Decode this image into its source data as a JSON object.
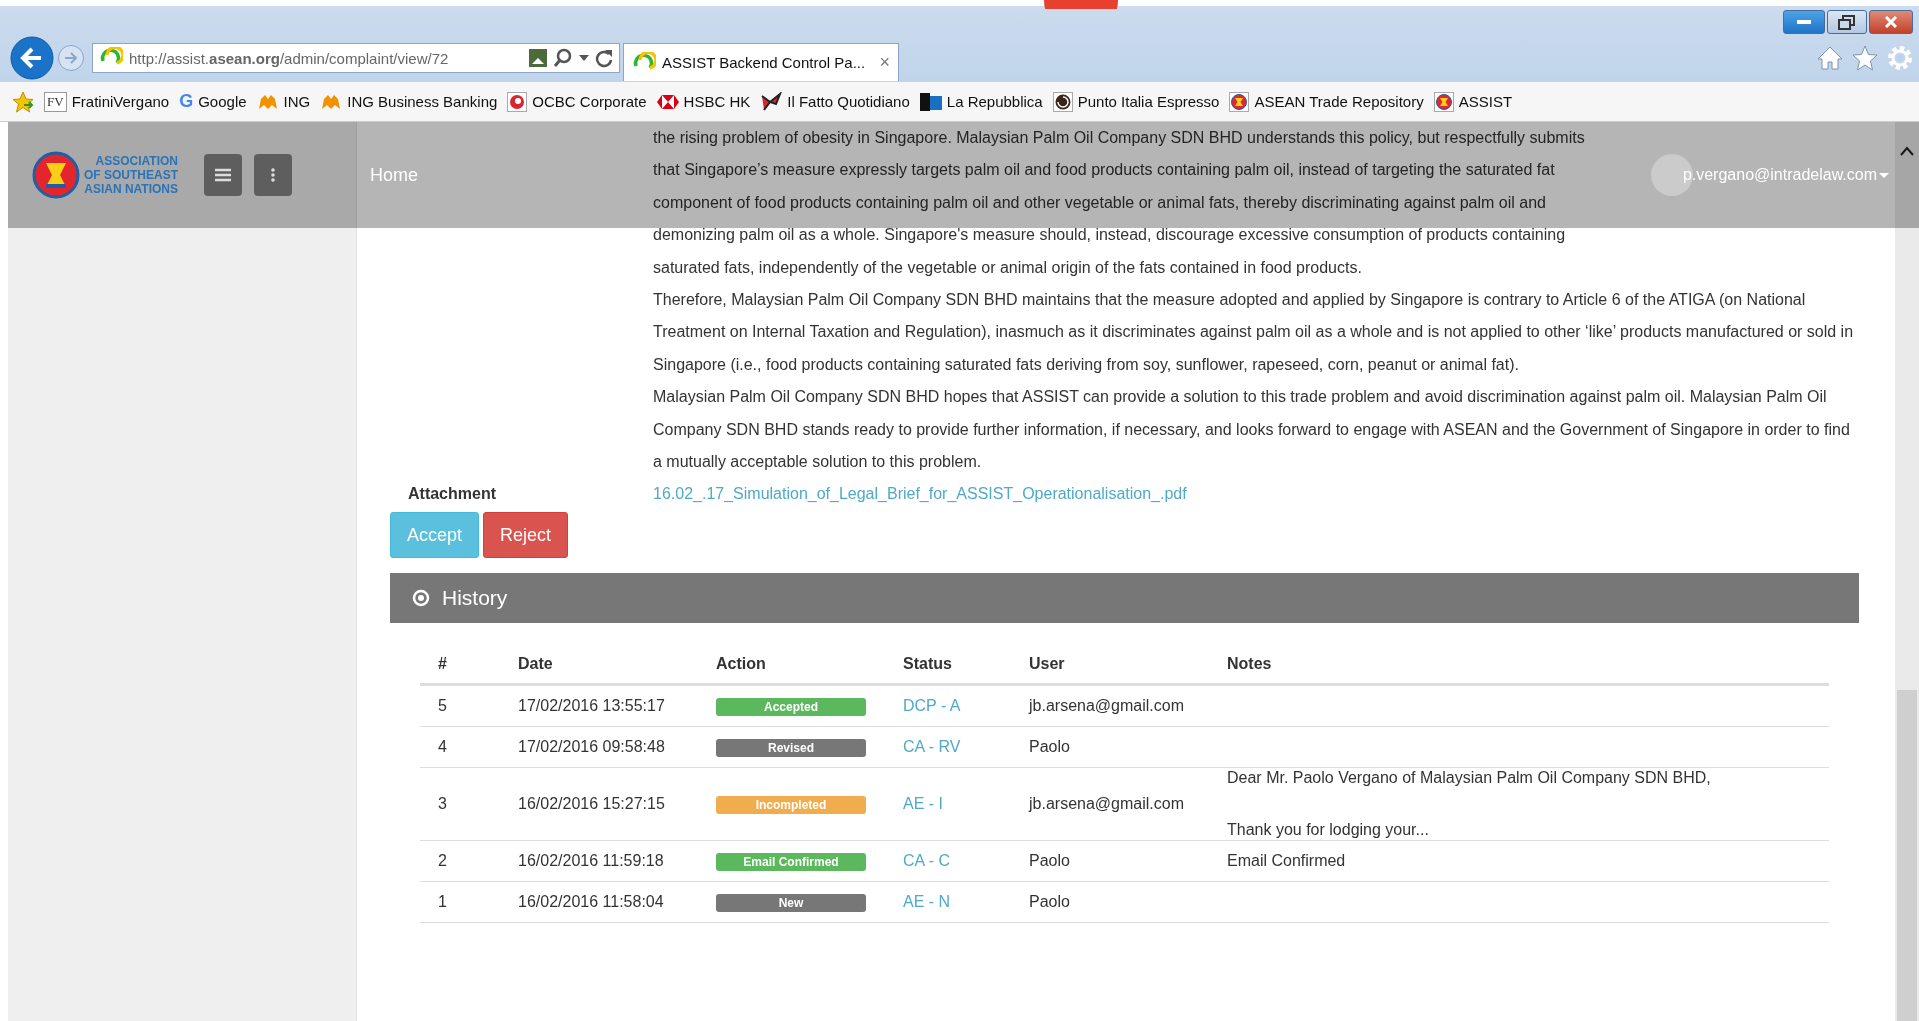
{
  "browser": {
    "address": "http://assist.**asean.org**/admin/complaint/view/72",
    "tab": {
      "title": "ASSIST Backend Control Pa...",
      "close": "×",
      "selected": true
    },
    "bookmarks": [
      {
        "kind": "favorites"
      },
      {
        "kind": "badge",
        "badge": "FV",
        "label": "FratiniVergano"
      },
      {
        "kind": "google",
        "badge": "G",
        "label": "Google"
      },
      {
        "kind": "lion",
        "label": "ING"
      },
      {
        "kind": "lion",
        "label": "ING Business Banking"
      },
      {
        "kind": "swirl",
        "label": "OCBC Corporate"
      },
      {
        "kind": "hexagon",
        "label": "HSBC HK"
      },
      {
        "kind": "bird",
        "label": "Il Fatto Quotidiano"
      },
      {
        "kind": "square",
        "label": "La Repubblica"
      },
      {
        "kind": "spiral",
        "label": "Punto Italia Espresso"
      },
      {
        "kind": "emblem",
        "label": "ASEAN Trade Repository"
      },
      {
        "kind": "emblem",
        "label": "ASSIST"
      }
    ]
  },
  "header": {
    "org_name": [
      "ASSOCIATION",
      "OF SOUTHEAST",
      "ASIAN NATIONS"
    ],
    "nav": "Home",
    "user": "p.vergano@intradelaw.com"
  },
  "complaint": {
    "paragraphs": [
      "the rising problem of obesity in Singapore. Malaysian Palm Oil Company SDN BHD understands this policy, but respectfully submits that Singapore’s measure expressly targets palm oil and food products containing palm oil, instead of targeting the saturated fat component of food products containing palm oil and other vegetable or animal fats, thereby discriminating against palm oil and demonizing palm oil as a whole. Singapore's measure should, instead, discourage excessive consumption of products containing saturated fats, independently of the vegetable or animal origin of the fats contained in food products.",
      "Therefore, Malaysian Palm Oil Company SDN BHD maintains that the measure adopted and applied by Singapore is contrary to Article 6 of the ATIGA (on National Treatment on Internal Taxation and Regulation), inasmuch as it discriminates against palm oil as a whole and is not applied to other ‘like’ products manufactured or sold in Singapore (i.e., food products containing saturated fats deriving from soy, sunflower, rapeseed, corn, peanut or animal fat).",
      "Malaysian Palm Oil Company SDN BHD hopes that ASSIST can provide a solution to this trade problem and avoid discrimination against palm oil. Malaysian Palm Oil Company SDN BHD stands ready to provide further information, if necessary, and looks forward to engage with ASEAN and the Government of Singapore in order to find a mutually acceptable solution to this problem."
    ],
    "attachment_label": "Attachment",
    "attachment": "16.02_.17_Simulation_of_Legal_Brief_for_ASSIST_Operationalisation_.pdf",
    "buttons": [
      {
        "label": "Accept",
        "kind": "accept"
      },
      {
        "label": "Reject",
        "kind": "reject"
      }
    ]
  },
  "history": {
    "title": "History",
    "columns": [
      "#",
      "Date",
      "Action",
      "Status",
      "User",
      "Notes"
    ],
    "rows": [
      {
        "num": "5",
        "date": "17/02/2016 13:55:17",
        "action": "Accepted",
        "color": "#5cb85c",
        "status": "DCP - A",
        "user": "jb.arsena@gmail.com"
      },
      {
        "num": "4",
        "date": "17/02/2016 09:58:48",
        "action": "Revised",
        "color": "#777777",
        "status": "CA - RV",
        "user": "Paolo"
      },
      {
        "num": "3",
        "date": "16/02/2016 15:27:15",
        "action": "Incompleted",
        "color": "#f0ad4e",
        "status": "AE - I",
        "user": "jb.arsena@gmail.com",
        "notes": [
          "Dear Mr. Paolo Vergano of Malaysian Palm Oil Company SDN BHD,",
          "Thank you for lodging your..."
        ]
      },
      {
        "num": "2",
        "date": "16/02/2016 11:59:18",
        "action": "Email Confirmed",
        "color": "#5cb85c",
        "status": "CA - C",
        "user": "Paolo",
        "notes": [
          "Email Confirmed"
        ]
      },
      {
        "num": "1",
        "date": "16/02/2016 11:58:04",
        "action": "New",
        "color": "#777777",
        "status": "AE - N",
        "user": "Paolo"
      }
    ]
  }
}
